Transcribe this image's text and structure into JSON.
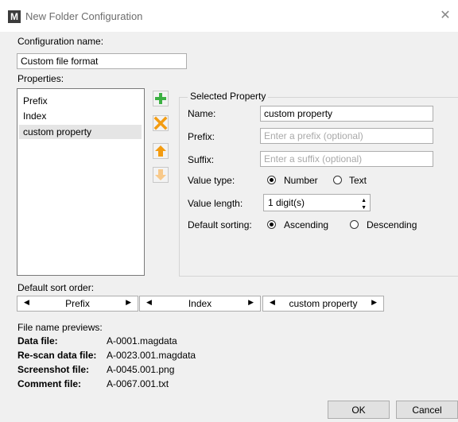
{
  "window": {
    "title": "New Folder Configuration",
    "app_icon": "M"
  },
  "config_name": {
    "label": "Configuration name:",
    "value": "Custom file format"
  },
  "properties": {
    "label": "Properties:",
    "items": [
      "Prefix",
      "Index",
      "custom property"
    ],
    "selected": "custom property"
  },
  "toolbar": {
    "add_icon": "plus-icon",
    "remove_icon": "x-icon",
    "up_icon": "arrow-up-icon",
    "down_icon": "arrow-down-icon",
    "colors": {
      "add": "#3cb043",
      "remove": "#f39c12",
      "up": "#f39c12",
      "down_disabled": "#f8c98a"
    }
  },
  "selected_property": {
    "group_title": "Selected Property",
    "name_label": "Name:",
    "name_value": "custom property",
    "prefix_label": "Prefix:",
    "prefix_placeholder": "Enter a prefix (optional)",
    "suffix_label": "Suffix:",
    "suffix_placeholder": "Enter a suffix (optional)",
    "value_type_label": "Value type:",
    "value_type_options": [
      "Number",
      "Text"
    ],
    "value_type_selected": "Number",
    "value_length_label": "Value length:",
    "value_length_value": "1 digit(s)",
    "default_sorting_label": "Default sorting:",
    "default_sorting_options": [
      "Ascending",
      "Descending"
    ],
    "default_sorting_selected": "Ascending"
  },
  "sort_order": {
    "label": "Default sort order:",
    "items": [
      "Prefix",
      "Index",
      "custom property"
    ]
  },
  "previews": {
    "label": "File name previews:",
    "rows": [
      {
        "label": "Data file:",
        "value": "A-0001.magdata"
      },
      {
        "label": "Re-scan data file:",
        "value": "A-0023.001.magdata"
      },
      {
        "label": "Screenshot file:",
        "value": "A-0045.001.png"
      },
      {
        "label": "Comment file:",
        "value": "A-0067.001.txt"
      }
    ]
  },
  "buttons": {
    "ok": "OK",
    "cancel": "Cancel"
  }
}
